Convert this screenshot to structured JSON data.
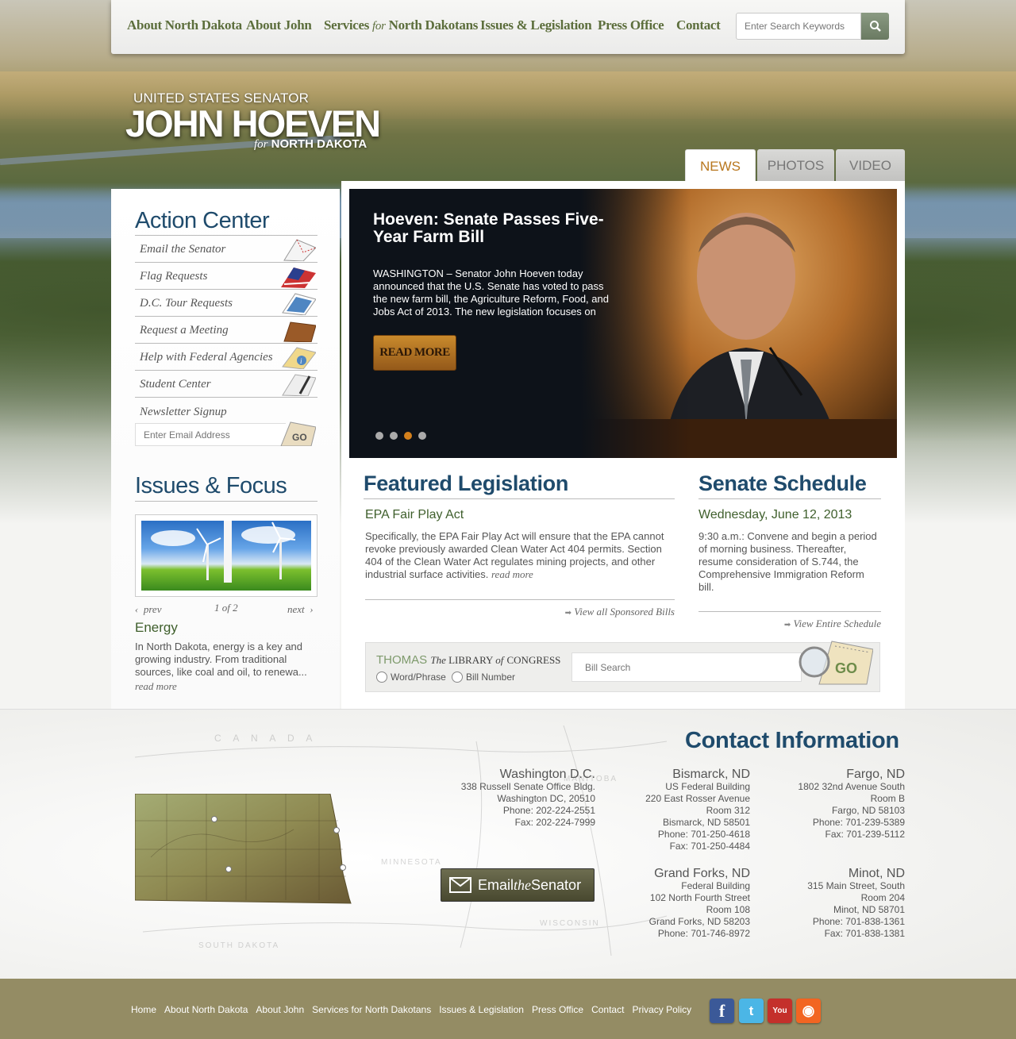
{
  "nav": {
    "items": [
      {
        "label": "About North Dakota"
      },
      {
        "label": "About John"
      },
      {
        "label_pre": "Services ",
        "label_for": "for",
        "label_post": " North Dakotans"
      },
      {
        "label": "Issues & Legislation"
      },
      {
        "label": "Press Office"
      },
      {
        "label": "Contact"
      }
    ],
    "search_placeholder": "Enter Search Keywords"
  },
  "logo": {
    "line1": "UNITED STATES SENATOR",
    "line2": "JOHN HOEVEN",
    "line3_for": "for",
    "line3": " NORTH DAKOTA"
  },
  "tabs": [
    "NEWS",
    "PHOTOS",
    "VIDEO"
  ],
  "action_center": {
    "title": "Action Center",
    "items": [
      {
        "label": "Email the Senator",
        "icon": "envelope-icon"
      },
      {
        "label": "Flag Requests",
        "icon": "flag-icon"
      },
      {
        "label": "D.C. Tour Requests",
        "icon": "photo-icon"
      },
      {
        "label": "Request a Meeting",
        "icon": "folder-icon"
      },
      {
        "label": "Help with Federal Agencies",
        "icon": "info-icon"
      },
      {
        "label": "Student Center",
        "icon": "pencil-icon"
      }
    ],
    "newsletter_label": "Newsletter Signup",
    "email_placeholder": "Enter Email Address",
    "go_label": "GO"
  },
  "issues": {
    "title": "Issues & Focus",
    "prev": "prev",
    "counter": "1 of 2",
    "next": "next",
    "heading": "Energy",
    "text": "In North Dakota, energy is a key and growing industry. From traditional sources, like coal and oil, to renewa...",
    "more": "read more"
  },
  "slider": {
    "title": "Hoeven: Senate Passes Five-Year Farm Bill",
    "text": "WASHINGTON – Senator John Hoeven today announced that the U.S. Senate has voted to pass the new farm bill, the Agriculture Reform, Food, and Jobs Act of 2013. The new legislation focuses on",
    "button": "READ MORE",
    "active_dot": 3,
    "dot_count": 4
  },
  "featured": {
    "title": "Featured Legislation",
    "heading": "EPA Fair Play Act",
    "text": "Specifically, the EPA Fair Play Act will ensure that the EPA cannot revoke previously awarded Clean Water Act 404 permits. Section 404 of the Clean Water Act regulates mining projects, and other industrial surface activities.",
    "more": "read more",
    "view_all": "View all Sponsored Bills"
  },
  "schedule": {
    "title": "Senate Schedule",
    "heading": "Wednesday, June 12, 2013",
    "text": "9:30 a.m.: Convene and begin a period of morning business. Thereafter, resume consideration of S.744, the Comprehensive Immigration Reform bill.",
    "view_all": "View Entire Schedule"
  },
  "thomas": {
    "brand": "THOMAS",
    "the": "The",
    "library": " LIBRARY ",
    "of": "of",
    "congress": "CONGRESS",
    "radio1": "Word/Phrase",
    "radio2": "Bill Number",
    "placeholder": "Bill Search",
    "go": "GO"
  },
  "contact": {
    "title": "Contact Information",
    "email_pre": "Email ",
    "email_the": "the",
    "email_post": " Senator",
    "offices": [
      {
        "city": "Washington D.C.",
        "lines": [
          "338 Russell Senate Office Bldg.",
          "Washington DC, 20510",
          "Phone: 202-224-2551",
          "Fax: 202-224-7999"
        ]
      },
      {
        "city": "Bismarck, ND",
        "lines": [
          "US Federal Building",
          "220 East Rosser Avenue",
          "Room 312",
          "Bismarck, ND 58501",
          "Phone: 701-250-4618",
          "Fax: 701-250-4484"
        ]
      },
      {
        "city": "Fargo, ND",
        "lines": [
          "1802 32nd Avenue South",
          "Room B",
          "Fargo, ND 58103",
          "Phone: 701-239-5389",
          "Fax: 701-239-5112"
        ]
      },
      {
        "city": "Grand Forks, ND",
        "lines": [
          "Federal Building",
          "102 North Fourth Street",
          "Room 108",
          "Grand Forks, ND 58203",
          "Phone: 701-746-8972"
        ]
      },
      {
        "city": "Minot, ND",
        "lines": [
          "315 Main Street, South",
          "Room 204",
          "Minot, ND 58701",
          "Phone: 701-838-1361",
          "Fax: 701-838-1381"
        ]
      }
    ],
    "map_labels": [
      "C A N A D A",
      "MANITOBA",
      "MINNESOTA",
      "SOUTH DAKOTA",
      "WISCONSIN"
    ]
  },
  "footer": {
    "links": [
      "Home",
      "About North Dakota",
      "About John",
      "Services for North Dakotans",
      "Issues & Legislation",
      "Press Office",
      "Contact",
      "Privacy Policy"
    ],
    "social": [
      {
        "name": "facebook-icon",
        "glyph": "f",
        "color": "#3b5998"
      },
      {
        "name": "twitter-icon",
        "glyph": "t",
        "color": "#4bb6e6"
      },
      {
        "name": "youtube-icon",
        "glyph": "You",
        "color": "#c4302b"
      },
      {
        "name": "rss-icon",
        "glyph": "◉",
        "color": "#f26522"
      }
    ]
  },
  "colors": {
    "accent_blue": "#1f4b6c",
    "accent_green": "#3f5f2c",
    "accent_orange": "#d4801c",
    "footer_bg": "#948c64"
  }
}
